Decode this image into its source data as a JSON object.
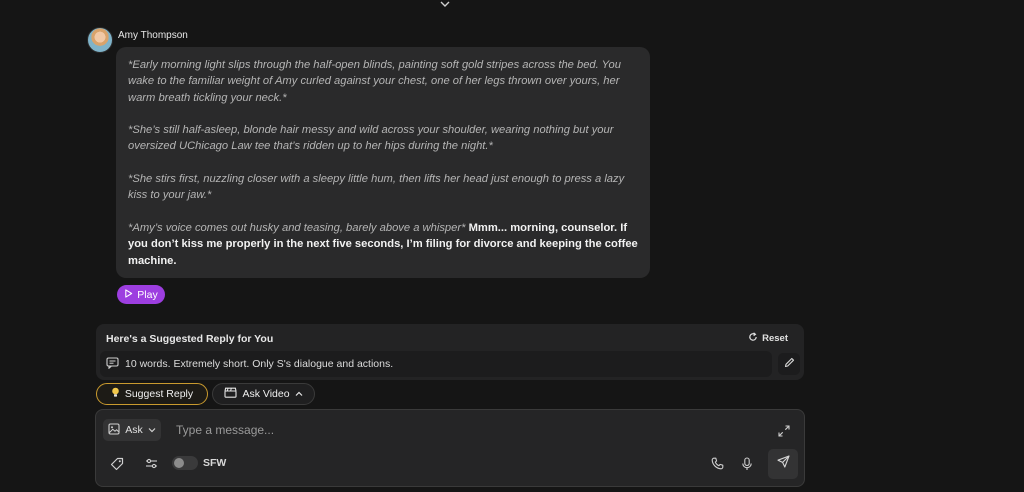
{
  "character": {
    "name": "Amy Thompson"
  },
  "message": {
    "paragraphs": [
      {
        "action": "*Early morning light slips through the half-open blinds, painting soft gold stripes across the bed. You wake to the familiar weight of Amy curled against your chest, one of her legs thrown over yours, her warm breath tickling your neck.*",
        "speech": ""
      },
      {
        "action": "*She’s still half-asleep, blonde hair messy and wild across your shoulder, wearing nothing but your oversized UChicago Law tee that’s ridden up to her hips during the night.*",
        "speech": ""
      },
      {
        "action": "*She stirs first, nuzzling closer with a sleepy little hum, then lifts her head just enough to press a lazy kiss to your jaw.*",
        "speech": ""
      },
      {
        "action": "*Amy’s voice comes out husky and teasing, barely above a whisper*",
        "speech": " Mmm... morning, counselor. If you don’t kiss me properly in the next five seconds, I’m filing for divorce and keeping the coffee machine."
      }
    ]
  },
  "play_button": {
    "label": "Play"
  },
  "suggestion": {
    "title": "Here's a Suggested Reply for You",
    "reset_label": "Reset",
    "prompt": "10 words. Extremely short. Only S's dialogue and actions."
  },
  "actions": {
    "suggest_reply": "Suggest Reply",
    "ask_video": "Ask Video"
  },
  "composer": {
    "mode": "Ask",
    "placeholder": "Type a message...",
    "sfw_label": "SFW",
    "sfw_enabled": false
  },
  "colors": {
    "background": "#151515",
    "bubble": "#2a2a2b",
    "play_accent": "#9d3ee0",
    "suggest_border": "#c99a2e"
  },
  "icons": [
    "chevron-down-icon",
    "play-icon",
    "reset-icon",
    "message-icon",
    "pencil-icon",
    "lightbulb-icon",
    "clapper-icon",
    "chevron-up-icon",
    "image-icon",
    "expand-icon",
    "tag-icon",
    "sliders-icon",
    "phone-icon",
    "microphone-icon",
    "send-icon"
  ]
}
